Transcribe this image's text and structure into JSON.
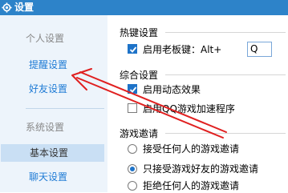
{
  "window": {
    "title": "设置",
    "icon": "gear-icon"
  },
  "sidebar": {
    "group_personal": "个人设置",
    "item_reminder": "提醒设置",
    "item_friend": "好友设置",
    "group_system": "系统设置",
    "item_basic": "基本设置",
    "item_chat": "聊天设置"
  },
  "hotkey": {
    "title": "热键设置",
    "boss_key_label": "启用老板键：Alt+",
    "boss_key_checked": true,
    "boss_key_value": "Q"
  },
  "general": {
    "title": "综合设置",
    "animation_label": "启用动态效果",
    "animation_checked": true,
    "qq_game_label": "启用QQ游戏加速程序",
    "qq_game_checked": false
  },
  "invite": {
    "title": "游戏邀请",
    "options": [
      {
        "label": "接受任何人的游戏邀请",
        "selected": false
      },
      {
        "label": "只接受游戏好友的游戏邀请",
        "selected": true
      },
      {
        "label": "拒绝任何人的游戏邀请",
        "selected": false
      }
    ]
  },
  "colors": {
    "titlebar": "#2d83c9",
    "sidebar": "#edf4fb",
    "link": "#1f7bd5",
    "accent": "#1e73c8",
    "annotation_arrow": "#e02020"
  }
}
